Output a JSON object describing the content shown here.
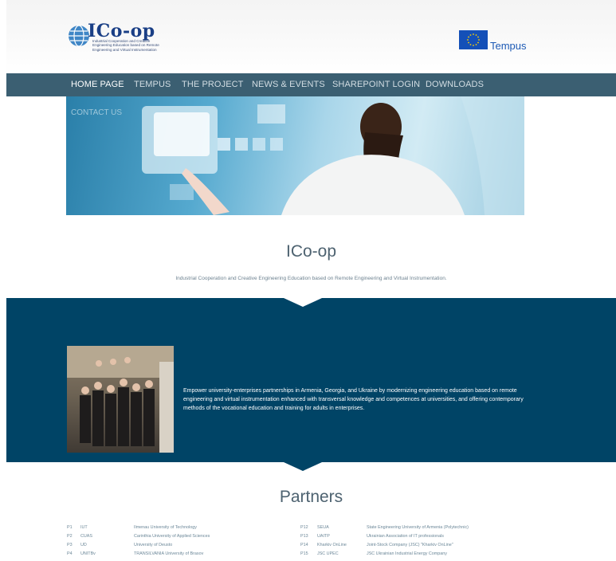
{
  "header": {
    "logo": {
      "title": "ICo-op",
      "subtitle": "Industrial Cooperation and Creative Engineering Education based on Remote Engineering and Virtual Instrumentation"
    },
    "tempus_label": "Tempus"
  },
  "nav": {
    "items": [
      {
        "label": "HOME PAGE",
        "active": true
      },
      {
        "label": "TEMPUS"
      },
      {
        "label": "THE PROJECT"
      },
      {
        "label": "NEWS & EVENTS"
      },
      {
        "label": "SHAREPOINT LOGIN"
      },
      {
        "label": "DOWNLOADS"
      }
    ],
    "contact_label": "CONTACT US"
  },
  "intro": {
    "title": "ICo-op",
    "text": "Industrial Cooperation and Creative Engineering Education based on Remote Engineering and Virtual Instrumentation."
  },
  "mission": {
    "text": "Empower university-enterprises partnerships in Armenia, Georgia, and Ukraine by modernizing engineering education based on remote engineering and virtual instrumentation enhanced with transversal knowledge and competences at universities, and offering contemporary methods of the vocational education and training for adults in enterprises."
  },
  "partners": {
    "title": "Partners",
    "left": [
      {
        "id": "P1",
        "abbr": "IUT",
        "name": "Ilmenau University of Technology"
      },
      {
        "id": "P2",
        "abbr": "CUAS",
        "name": "Carinthia University of Applied Sciences"
      },
      {
        "id": "P3",
        "abbr": "UD",
        "name": "University of Deusto"
      },
      {
        "id": "P4",
        "abbr": "UNITBv",
        "name": "TRANSILVANIA University of Brasov"
      }
    ],
    "right": [
      {
        "id": "P12",
        "abbr": "SEUA",
        "name": "State Engineering University of Armenia (Polytechnic)"
      },
      {
        "id": "P13",
        "abbr": "UAITP",
        "name": "Ukrainian Association of IT professionals"
      },
      {
        "id": "P14",
        "abbr": "Kharkiv OnLine",
        "name": "Joint-Stock Company (JSC) \"Kharkiv OnLine\""
      },
      {
        "id": "P15",
        "abbr": "JSC UPEC",
        "name": "JSC Ukrainian Industrial Energy Company"
      }
    ]
  },
  "colors": {
    "nav_bg": "#3b5f72",
    "mission_bg": "#004466",
    "heading": "#4d6270",
    "brand": "#1a3f86"
  }
}
